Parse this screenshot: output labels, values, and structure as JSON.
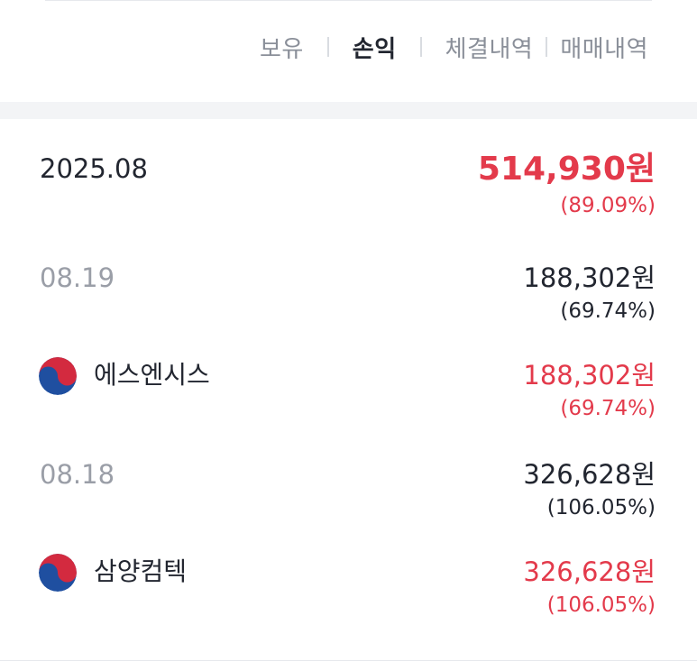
{
  "tabs": [
    {
      "label": "보유",
      "active": false
    },
    {
      "label": "손익",
      "active": true
    },
    {
      "label": "체결내역",
      "active": false
    },
    {
      "label": "매매내역",
      "active": false
    }
  ],
  "month_summary": {
    "label": "2025.08",
    "amount": "514,930원",
    "percent": "(89.09%)"
  },
  "days": [
    {
      "date": "08.19",
      "amount": "188,302원",
      "percent": "(69.74%)",
      "stocks": [
        {
          "name": "에스엔시스",
          "flag_icon": "korea-flag-icon",
          "amount": "188,302원",
          "percent": "(69.74%)"
        }
      ]
    },
    {
      "date": "08.18",
      "amount": "326,628원",
      "percent": "(106.05%)",
      "stocks": [
        {
          "name": "삼양컴텍",
          "flag_icon": "korea-flag-icon",
          "amount": "326,628원",
          "percent": "(106.05%)"
        }
      ]
    }
  ],
  "colors": {
    "profit": "#e33a4b",
    "text": "#222630",
    "muted": "#9a9ea7",
    "flag_red": "#d32a3f",
    "flag_blue": "#1f4fa0"
  }
}
